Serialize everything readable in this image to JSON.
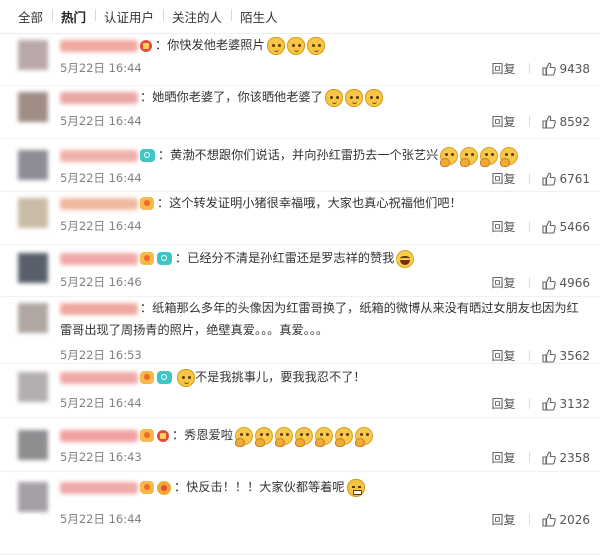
{
  "tabs": [
    "全部",
    "热门",
    "认证用户",
    "关注的人",
    "陌生人"
  ],
  "active_tab": "热门",
  "reply_label": "回复",
  "comments": [
    {
      "text": "：你快发他老婆照片",
      "date": "5月22日 16:44",
      "likes": "9438",
      "emojis": [
        "cat",
        "cat",
        "cat"
      ],
      "badges": [
        "red"
      ],
      "avatar_color": "#b9a8a8",
      "nick_color": "#f0a8a0"
    },
    {
      "text": "：她晒你老婆了，你该晒他老婆了",
      "date": "5月22日 16:44",
      "likes": "8592",
      "emojis": [
        "cat",
        "cat",
        "cat"
      ],
      "badges": [],
      "avatar_color": "#a08d86",
      "nick_color": "#e9a6a6"
    },
    {
      "text": "：黄渤不想跟你们说话，并向孙红雷扔去一个张艺兴",
      "date": "5月22日 16:44",
      "likes": "6761",
      "emojis": [
        "think",
        "think",
        "think",
        "think"
      ],
      "badges": [
        "cam"
      ],
      "avatar_color": "#8d8d95",
      "nick_color": "#f0b0aa"
    },
    {
      "text": "：这个转发证明小猪很幸福哦，大家也真心祝福他们吧！",
      "date": "5月22日 16:44",
      "likes": "5466",
      "emojis": [],
      "badges": [
        "vip"
      ],
      "avatar_color": "#c9bca6",
      "nick_color": "#f0b8a0"
    },
    {
      "text": "：已经分不清是孙红雷还是罗志祥的赞我",
      "date": "5月22日 16:46",
      "likes": "4966",
      "emojis": [
        "laugh"
      ],
      "badges": [
        "vip",
        "cam"
      ],
      "avatar_color": "#59606c",
      "nick_color": "#f0a8a8"
    },
    {
      "text": "：纸箱那么多年的头像因为红雷哥换了，纸箱的微博从来没有晒过女朋友也因为红雷哥出现了周扬青的照片，绝壁真爱。。。真爱。。。",
      "date": "5月22日 16:53",
      "likes": "3562",
      "emojis": [],
      "badges": [],
      "avatar_color": "#b0a8a0",
      "nick_color": "#f0a8a0"
    },
    {
      "text": "不是我挑事儿，要我我忍不了！",
      "date": "5月22日 16:44",
      "likes": "3132",
      "emojis": [
        "cat"
      ],
      "emoji_first": true,
      "badges": [
        "vip",
        "cam"
      ],
      "avatar_color": "#b4aeb0",
      "nick_color": "#f0a8a8"
    },
    {
      "text": "：秀恩爱啦",
      "date": "5月22日 16:43",
      "likes": "2358",
      "emojis": [
        "think",
        "think",
        "think",
        "think",
        "think",
        "think",
        "think"
      ],
      "badges": [
        "vip",
        "red"
      ],
      "avatar_color": "#8f8c90",
      "nick_color": "#f0a0a0"
    },
    {
      "text": "：快反击！！！大家伙都等着呢",
      "date": "5月22日 16:44",
      "likes": "2026",
      "emojis": [
        "grin"
      ],
      "badges": [
        "vip",
        "gold"
      ],
      "avatar_color": "#a6a0a6",
      "nick_color": "#f0a8a8"
    }
  ]
}
